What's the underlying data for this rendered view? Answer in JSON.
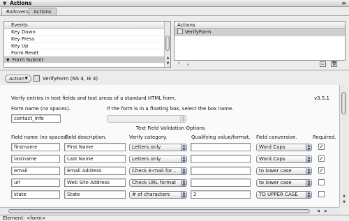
{
  "window": {
    "title": "Actions",
    "menu_glyph": "≡",
    "collapse_glyph": "▼"
  },
  "tabs": [
    {
      "label": "Rollovers"
    },
    {
      "label": "Actions"
    }
  ],
  "events": {
    "header": "Events",
    "items": [
      "Key Down",
      "Key Press",
      "Key Up",
      "Form Reset",
      "Form Submit"
    ],
    "selected": "Form Submit"
  },
  "actions": {
    "header": "Actions",
    "items": [
      "VerifyForm"
    ]
  },
  "action_bar": {
    "menu_label": "Action",
    "action_title": "VerifyForm (NS 4, IE 4)"
  },
  "form": {
    "description": "Verify entries in text fields and text areas of a standard HTML form.",
    "version": "v3.5.1",
    "form_name_label": "Form name (no spaces).",
    "form_name_value": "contact_info",
    "floating_box_label": "If the form is in a floating box, select the box name.",
    "floating_box_value": "",
    "section_title": "Text Field Validation Options",
    "columns": [
      "Field name (no spaces).",
      "Field description.",
      "Verify category.",
      "Qualifying value/format.",
      "Field conversion.",
      "Required."
    ],
    "rows": [
      {
        "name": "firstname",
        "description": "First Name",
        "category": "Letters only",
        "qualifier": "",
        "conversion": "Word Caps",
        "required": true
      },
      {
        "name": "lastname",
        "description": "Last Name",
        "category": "Letters only",
        "qualifier": "",
        "conversion": "Word Caps",
        "required": true
      },
      {
        "name": "email",
        "description": "Email Address",
        "category": "Check E-mail for...",
        "qualifier": "",
        "conversion": "to lower case",
        "required": true
      },
      {
        "name": "url",
        "description": "Web Site Address",
        "category": "Check URL format",
        "qualifier": "",
        "conversion": "to lower case",
        "required": false
      },
      {
        "name": "state",
        "description": "State",
        "category": "# of characters",
        "qualifier": "2",
        "conversion": "TO UPPER CASE",
        "required": false
      }
    ]
  },
  "status": {
    "text": "Element: <form>"
  },
  "colors": {
    "panel_bg": "#ececec",
    "selection": "#c9c9c9",
    "content_bg": "#fafafa"
  }
}
